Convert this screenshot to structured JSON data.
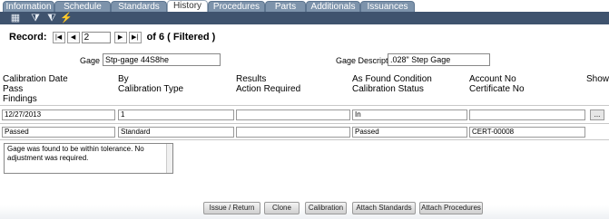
{
  "tabs": [
    "Information",
    "Schedule",
    "Standards",
    "History",
    "Procedures",
    "Parts",
    "Additionals",
    "Issuances"
  ],
  "active_tab": "History",
  "record": {
    "label": "Record:",
    "value": "2",
    "of_text": "of 6 ( Filtered )"
  },
  "gage": {
    "id_label": "Gage ID",
    "id_value": "Stp-gage 44S8he",
    "desc_label": "Gage Description",
    "desc_value": ".028\" Step Gage"
  },
  "headers": {
    "calibration_date": "Calibration Date",
    "by": "By",
    "results": "Results",
    "as_found_condition": "As Found Condition",
    "account_no": "Account No",
    "show": "Show",
    "pass": "Pass",
    "calibration_type": "Calibration Type",
    "action_required": "Action Required",
    "calibration_status": "Calibration Status",
    "certificate_no": "Certificate No",
    "findings": "Findings"
  },
  "row1": {
    "calibration_date": "12/27/2013",
    "by": "1",
    "results": "",
    "as_found_condition": "In",
    "account_no": "",
    "more": "..."
  },
  "row2": {
    "pass": "Passed",
    "calibration_type": "Standard",
    "action_required": "",
    "calibration_status": "Passed",
    "certificate_no": "CERT-00008"
  },
  "findings_text": "Gage was found to be within tolerance. No adjustment was required.",
  "buttons": {
    "issue_return": "Issue / Return",
    "clone": "Clone",
    "calibration": "Calibration",
    "attach_standards": "Attach Standards",
    "attach_procedures": "Attach Procedures"
  },
  "colors": {
    "tab": "#7d93ab",
    "toolbar": "#3f536e"
  }
}
